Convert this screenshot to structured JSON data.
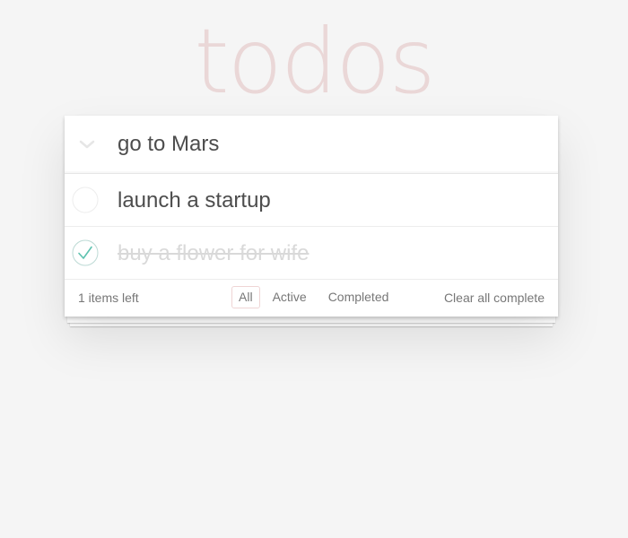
{
  "header": {
    "title": "todos"
  },
  "new_todo": {
    "value": "go to Mars",
    "placeholder": ""
  },
  "todos": [
    {
      "label": "launch a startup",
      "completed": false
    },
    {
      "label": "buy a flower for wife",
      "completed": true
    }
  ],
  "footer": {
    "count_text": "1 items left",
    "filters": [
      "All",
      "Active",
      "Completed"
    ],
    "selected_filter": "All",
    "clear_label": "Clear all complete"
  },
  "colors": {
    "title": "#efd5d5",
    "check_green": "#5dc2af",
    "circle_border": "#ededed",
    "selected_filter_border": "#efd5d5"
  },
  "icons": {
    "toggle_all": "chevron-down-icon",
    "item_unchecked": "circle-icon",
    "item_checked": "checkmark-circle-icon"
  }
}
